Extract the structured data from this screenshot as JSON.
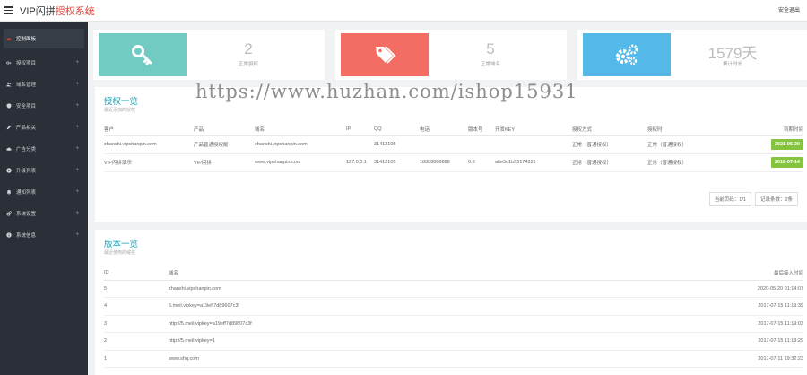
{
  "header": {
    "logo_main": "VIP闪拼",
    "logo_accent": "授权系统",
    "logout_label": "安全退出"
  },
  "sidebar": {
    "items": [
      {
        "label": "控制面板",
        "icon": "dashboard-icon"
      },
      {
        "label": "授权项目",
        "icon": "key-icon"
      },
      {
        "label": "域名管理",
        "icon": "users-icon"
      },
      {
        "label": "安全项目",
        "icon": "shield-icon"
      },
      {
        "label": "产品相关",
        "icon": "pencil-icon"
      },
      {
        "label": "广告分类",
        "icon": "cloud-icon"
      },
      {
        "label": "升级列表",
        "icon": "play-icon"
      },
      {
        "label": "通知列表",
        "icon": "bell-icon"
      },
      {
        "label": "系统设置",
        "icon": "gears-icon"
      },
      {
        "label": "系统信息",
        "icon": "info-icon"
      }
    ]
  },
  "stats": [
    {
      "value": "2",
      "label": "正常授权",
      "color": "#72cbc2",
      "icon": "key-icon"
    },
    {
      "value": "5",
      "label": "正常域名",
      "color": "#f46d62",
      "icon": "tags-icon"
    },
    {
      "value": "1579天",
      "label": "累计时长",
      "color": "#54b8e8",
      "icon": "gears-icon"
    }
  ],
  "license_panel": {
    "title": "授权一览",
    "subtitle": "最近添加的授权",
    "headers": [
      "客户",
      "产品",
      "域名",
      "IP",
      "QQ",
      "电话",
      "版本号",
      "开发KEY",
      "授权方式",
      "授权时",
      "到期时间"
    ],
    "rows": [
      [
        "zhanshi.vipshanpin.com",
        "产品普通授权版",
        "zhanshi.vipshanpin.com",
        "",
        "31412105",
        "",
        "",
        "",
        "正常（普通授权）",
        "正常（普通授权）",
        "2021-05-20"
      ],
      [
        "VIP闪拼演示",
        "VIP闪拼",
        "www.vipshanpin.com",
        "127.0.0.1",
        "31412105",
        "18888888888",
        "6.8",
        "a6e5c1b53174321",
        "正常（普通授权）",
        "正常（普通授权）",
        "2018-07-14"
      ]
    ],
    "pager": {
      "pages": "当前页码：1/1",
      "total": "记录条数：2条"
    }
  },
  "version_panel": {
    "title": "版本一览",
    "subtitle": "最近使用的域名",
    "headers": [
      "ID",
      "域名",
      "最后接入时间"
    ],
    "rows": [
      [
        "5",
        "zhanshi.vipshanpin.com",
        "2020-05-20 01:14:07"
      ],
      [
        "4",
        "5.meil.vipkey=a19eff7d89607c3f",
        "2017-07-15 11:19:39"
      ],
      [
        "3",
        "http://5.meil.vipkey=a19eff7d89607c3f",
        "2017-07-15 11:19:03"
      ],
      [
        "2",
        "http://5.meil.vipkey=1",
        "2017-07-15 11:18:29"
      ],
      [
        "1",
        "www.shq.com",
        "2017-07-11 19:32:23"
      ]
    ]
  },
  "watermark": "https://www.huzhan.com/ishop15931"
}
